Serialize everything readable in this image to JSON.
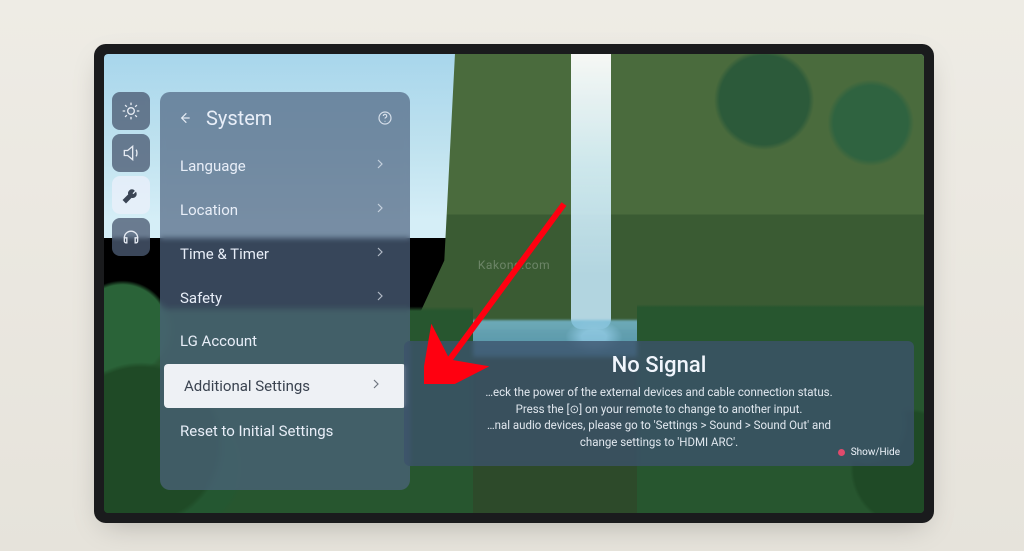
{
  "watermark": "Kakond.com",
  "panel": {
    "title": "System",
    "items": [
      {
        "label": "Language",
        "has_submenu": true
      },
      {
        "label": "Location",
        "has_submenu": true
      },
      {
        "label": "Time & Timer",
        "has_submenu": true
      },
      {
        "label": "Safety",
        "has_submenu": true
      },
      {
        "label": "LG Account",
        "has_submenu": false
      },
      {
        "label": "Additional Settings",
        "has_submenu": true,
        "selected": true
      },
      {
        "label": "Reset to Initial Settings",
        "has_submenu": false
      }
    ]
  },
  "icon_rail": [
    {
      "name": "brightness-icon"
    },
    {
      "name": "volume-icon"
    },
    {
      "name": "wrench-icon",
      "active": true
    },
    {
      "name": "headset-icon"
    }
  ],
  "toast": {
    "title": "No Signal",
    "line1": "…eck the power of the external devices and cable connection status.",
    "line2": "Press the [⊙] on your remote to change to another input.",
    "line3": "…nal audio devices, please go to 'Settings > Sound > Sound Out' and",
    "line4": "change settings to 'HDMI ARC'.",
    "hint": "Show/Hide"
  }
}
